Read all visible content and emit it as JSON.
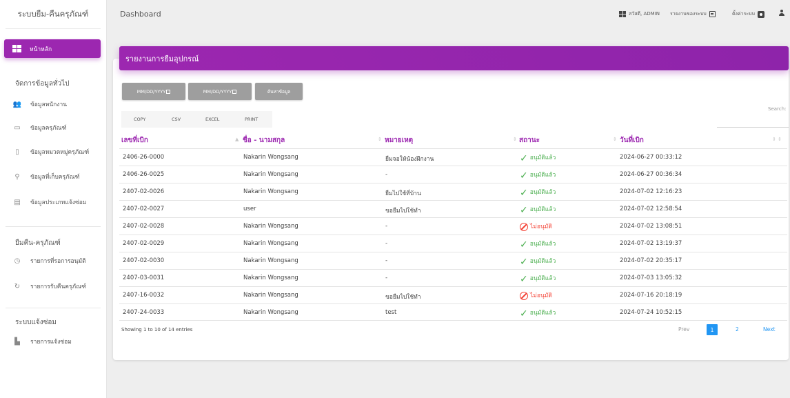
{
  "app": {
    "brand": "ระบบยืม-คืนครุภัณฑ์",
    "page_title": "Dashboard"
  },
  "topbar": {
    "greeting": "สวัสดี, ADMIN",
    "report_link": "รายงานของระบบ",
    "settings_link": "ตั้งค่าระบบ"
  },
  "sidebar": {
    "home": "หน้าหลัก",
    "section_general": "จัดการข้อมูลทั่วไป",
    "general_items": [
      "ข้อมูลพนักงาน",
      "ข้อมูลครุภัณฑ์",
      "ข้อมูลหมวดหมู่ครุภัณฑ์",
      "ข้อมูลที่เก็บครุภัณฑ์",
      "ข้อมูลประเภทแจ้งซ่อม"
    ],
    "section_borrow": "ยืมคืน-ครุภัณฑ์",
    "borrow_items": [
      "รายการที่รอการอนุมัติ",
      "รายการรับคืนครุภัณฑ์"
    ],
    "section_repair": "ระบบแจ้งซ่อม",
    "repair_items": [
      "รายการแจ้งซ่อม"
    ]
  },
  "card": {
    "title": "รายงานการยืมอุปกรณ์",
    "date_from_placeholder": "MM/DD/YYYY",
    "date_to_placeholder": "MM/DD/YYYY",
    "search_button": "ค้นหาข้อมูล",
    "export_buttons": [
      "COPY",
      "CSV",
      "EXCEL",
      "PRINT"
    ],
    "search_label": "Search:"
  },
  "table": {
    "headers": [
      "เลขที่เบิก",
      "ชื่อ - นามสกุล",
      "หมายเหตุ",
      "สถานะ",
      "วันที่เบิก"
    ],
    "rows": [
      {
        "id": "2406-26-0000",
        "name": "Nakarin Wongsang",
        "note": "ยืมจอให้น้องฝึกงาน",
        "status": "อนุมัติแล้ว",
        "approved": true,
        "date": "2024-06-27 00:33:12"
      },
      {
        "id": "2406-26-0025",
        "name": "Nakarin Wongsang",
        "note": "-",
        "status": "อนุมัติแล้ว",
        "approved": true,
        "date": "2024-06-27 00:36:34"
      },
      {
        "id": "2407-02-0026",
        "name": "Nakarin Wongsang",
        "note": "ยืมไปใช้ที่บ้าน",
        "status": "อนุมัติแล้ว",
        "approved": true,
        "date": "2024-07-02 12:16:23"
      },
      {
        "id": "2407-02-0027",
        "name": "user",
        "note": "ขอยืมไปใช้ทำ",
        "status": "อนุมัติแล้ว",
        "approved": true,
        "date": "2024-07-02 12:58:54"
      },
      {
        "id": "2407-02-0028",
        "name": "Nakarin Wongsang",
        "note": "-",
        "status": "ไม่อนุมัติ",
        "approved": false,
        "date": "2024-07-02 13:08:51"
      },
      {
        "id": "2407-02-0029",
        "name": "Nakarin Wongsang",
        "note": "-",
        "status": "อนุมัติแล้ว",
        "approved": true,
        "date": "2024-07-02 13:19:37"
      },
      {
        "id": "2407-02-0030",
        "name": "Nakarin Wongsang",
        "note": "-",
        "status": "อนุมัติแล้ว",
        "approved": true,
        "date": "2024-07-02 20:35:17"
      },
      {
        "id": "2407-03-0031",
        "name": "Nakarin Wongsang",
        "note": "-",
        "status": "อนุมัติแล้ว",
        "approved": true,
        "date": "2024-07-03 13:05:32"
      },
      {
        "id": "2407-16-0032",
        "name": "Nakarin Wongsang",
        "note": "ขอยืมไปใช้ทำ",
        "status": "ไม่อนุมัติ",
        "approved": false,
        "date": "2024-07-16 20:18:19"
      },
      {
        "id": "2407-24-0033",
        "name": "Nakarin Wongsang",
        "note": "test",
        "status": "อนุมัติแล้ว",
        "approved": true,
        "date": "2024-07-24 10:52:15"
      }
    ],
    "info": "Showing 1 to 10 of 14 entries"
  },
  "pagination": {
    "prev": "Prev",
    "pages": [
      "1",
      "2"
    ],
    "current": "1",
    "next": "Next"
  }
}
